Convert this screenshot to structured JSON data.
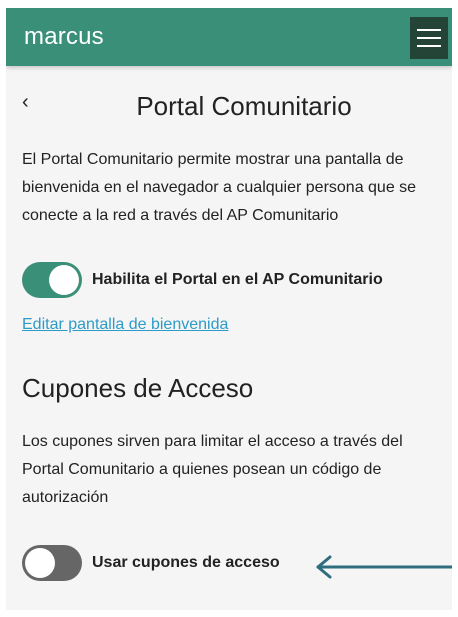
{
  "header": {
    "brand": "marcus",
    "menu_icon": "hamburger-icon"
  },
  "page": {
    "back_icon": "chevron-left-icon",
    "back_glyph": "‹",
    "title": "Portal Comunitario",
    "description": "El Portal Comunitario permite mostrar una pantalla de bienvenida en el navegador a cualquier persona que se conecte a la red a través del AP Comunitario"
  },
  "portal_toggle": {
    "label": "Habilita el Portal en el AP Comunitario",
    "state": "on"
  },
  "edit_link": "Editar pantalla de bienvenida",
  "coupons": {
    "title": "Cupones de Acceso",
    "description": "Los cupones sirven para limitar el acceso a través del Portal Comunitario a quienes posean un código de autorización",
    "toggle": {
      "label": "Usar cupones de acceso",
      "state": "off"
    },
    "annotation_icon": "arrow-left-icon"
  },
  "colors": {
    "primary": "#3a8f78",
    "menu_button": "#244438",
    "link": "#2d9bc8",
    "toggle_off": "#666666",
    "annotation_arrow": "#2e6e7e",
    "background": "#f5f5f5"
  }
}
